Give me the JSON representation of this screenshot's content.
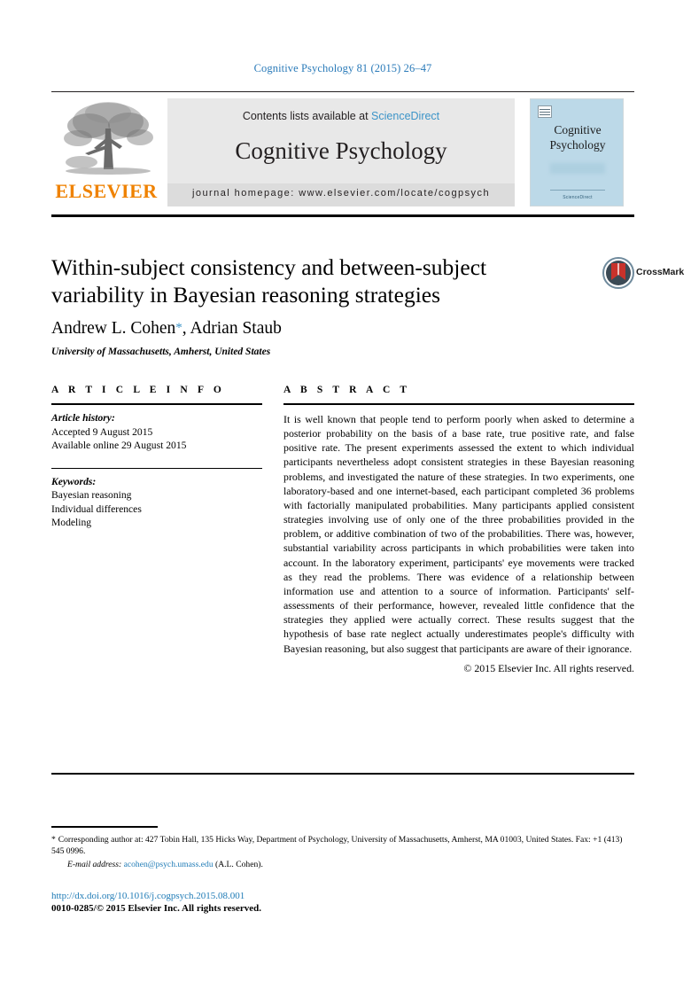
{
  "running_head": "Cognitive Psychology 81 (2015) 26–47",
  "masthead": {
    "contents_prefix": "Contents lists available at ",
    "sciencedirect": "ScienceDirect",
    "journal_name": "Cognitive Psychology",
    "homepage": "journal homepage: www.elsevier.com/locate/cogpsych",
    "publisher_wordmark": "ELSEVIER",
    "publisher_logo_icon": "elsevier-tree-icon",
    "link_color": "#3c94c8",
    "wordmark_color": "#ef8200",
    "box_color": "#e8e8e8"
  },
  "cover": {
    "title": "Cognitive Psychology",
    "footer_text": "ScienceDirect",
    "background_color": "#bcd9e8"
  },
  "article": {
    "title": "Within-subject consistency and between-subject variability in Bayesian reasoning strategies",
    "authors_prefix": "Andrew L. Cohen",
    "author_star": "*",
    "authors_suffix": ", Adrian Staub",
    "affiliation": "University of Massachusetts, Amherst, United States"
  },
  "crossmark": {
    "label": "CrossMark",
    "icon": "crossmark-badge-icon"
  },
  "info": {
    "heading": "A R T I C L E    I N F O",
    "history_label": "Article history:",
    "history_lines": [
      "Accepted 9 August 2015",
      "Available online 29 August 2015"
    ],
    "keywords_label": "Keywords:",
    "keywords": [
      "Bayesian reasoning",
      "Individual differences",
      "Modeling"
    ]
  },
  "abstract": {
    "heading": "A B S T R A C T",
    "text": "It is well known that people tend to perform poorly when asked to determine a posterior probability on the basis of a base rate, true positive rate, and false positive rate. The present experiments assessed the extent to which individual participants nevertheless adopt consistent strategies in these Bayesian reasoning problems, and investigated the nature of these strategies. In two experiments, one laboratory-based and one internet-based, each participant completed 36 problems with factorially manipulated probabilities. Many participants applied consistent strategies involving use of only one of the three probabilities provided in the problem, or additive combination of two of the probabilities. There was, however, substantial variability across participants in which probabilities were taken into account. In the laboratory experiment, participants' eye movements were tracked as they read the problems. There was evidence of a relationship between information use and attention to a source of information. Participants' self-assessments of their performance, however, revealed little confidence that the strategies they applied were actually correct. These results suggest that the hypothesis of base rate neglect actually underestimates people's difficulty with Bayesian reasoning, but also suggest that participants are aware of their ignorance.",
    "copyright": "© 2015 Elsevier Inc. All rights reserved."
  },
  "footer": {
    "corresponding_marker": "*",
    "corresponding_text": " Corresponding author at: 427 Tobin Hall, 135 Hicks Way, Department of Psychology, University of Massachusetts, Amherst, MA 01003, United States. Fax: +1 (413) 545 0996.",
    "email_label": "E-mail address:",
    "email": "acohen@psych.umass.edu",
    "email_suffix": " (A.L. Cohen).",
    "doi": "http://dx.doi.org/10.1016/j.cogpsych.2015.08.001",
    "issn_line": "0010-0285/© 2015 Elsevier Inc. All rights reserved."
  }
}
